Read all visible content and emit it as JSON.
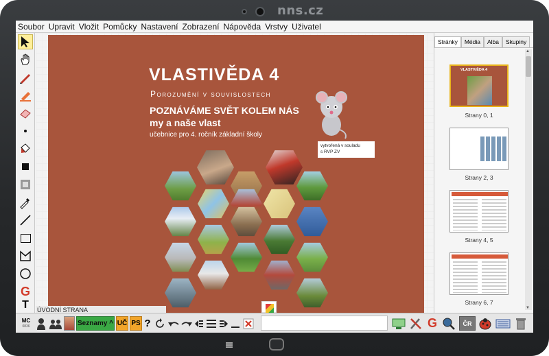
{
  "brand": "nns.cz",
  "menu": [
    "Soubor",
    "Upravit",
    "Vložit",
    "Pomůcky",
    "Nastavení",
    "Zobrazení",
    "Nápověda",
    "Vrstvy",
    "Uživatel"
  ],
  "cover": {
    "title": "VLASTIVĚDA 4",
    "subtitle": "Porozumění v souvislostech",
    "heading1": "POZNÁVÁME SVĚT KOLEM NÁS",
    "heading2": "my a naše vlast",
    "heading3": "učebnice pro 4. ročník základní školy",
    "rvp_line1": "vytvořená v souladu",
    "rvp_line2": "s RVP ZV"
  },
  "page_label": "ÚVODNÍ STRANA",
  "panel": {
    "tabs": [
      "Stránky",
      "Média",
      "Alba",
      "Skupiny"
    ],
    "thumbs": [
      "Strany 0, 1",
      "Strany 2, 3",
      "Strany 4, 5",
      "Strany 6, 7"
    ]
  },
  "bottom": {
    "mc": "MC",
    "mc_sub": "0836",
    "lists": "Seznamy ^",
    "uc": "UČ",
    "ps": "PS",
    "help": "?",
    "cr": "ČR"
  },
  "colors": {
    "cover_bg": "#a8553c",
    "lists_green": "#3aa844",
    "uc_orange": "#f2a52a"
  }
}
